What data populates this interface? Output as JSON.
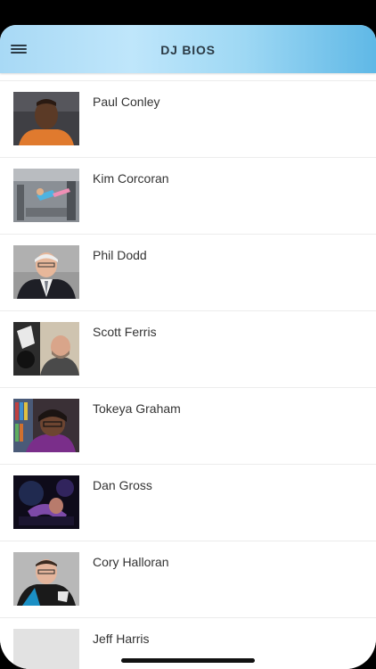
{
  "header": {
    "title": "DJ BIOS",
    "menu_icon": "hamburger-menu-icon"
  },
  "djs": [
    {
      "name": "Paul Conley"
    },
    {
      "name": "Kim Corcoran"
    },
    {
      "name": "Phil Dodd"
    },
    {
      "name": "Scott Ferris"
    },
    {
      "name": "Tokeya Graham"
    },
    {
      "name": "Dan Gross"
    },
    {
      "name": "Cory Halloran"
    },
    {
      "name": "Jeff Harris"
    }
  ],
  "colors": {
    "header_gradient_start": "#a8d9f5",
    "header_gradient_end": "#5fb8e6",
    "title_text": "#2b3a45",
    "name_text": "#333333"
  }
}
